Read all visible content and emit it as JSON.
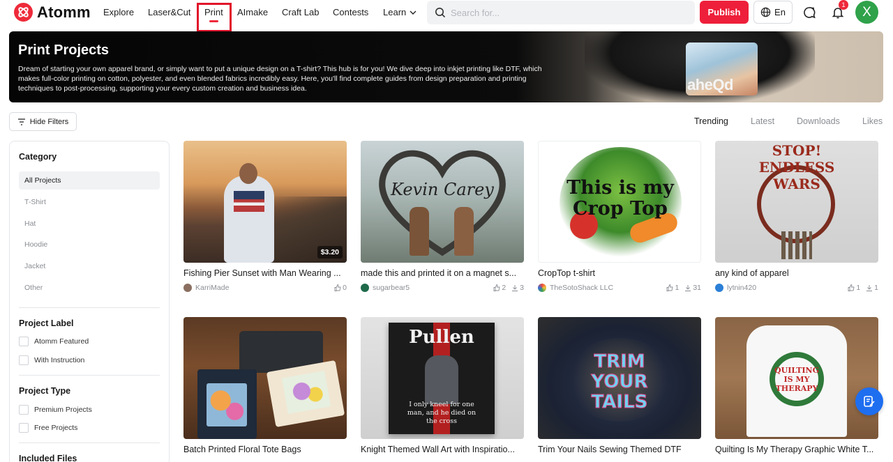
{
  "brand": {
    "name": "Atomm",
    "accent": "#ee2a3a"
  },
  "nav": {
    "items": [
      "Explore",
      "Laser&Cut",
      "Print",
      "AImake",
      "Craft Lab",
      "Contests",
      "Learn"
    ],
    "active": "Print"
  },
  "search": {
    "placeholder": "Search for..."
  },
  "header": {
    "publish_label": "Publish",
    "language": "En",
    "notification_count": "1",
    "user_initial": "X"
  },
  "hero": {
    "title": "Print Projects",
    "description": "Dream of starting your own apparel brand, or simply want to put a unique design on a T-shirt? This hub is for you! We dive deep into inkjet printing like DTF, which makes full-color printing on cotton, polyester, and even blended fabrics incredibly easy. Here, you'll find complete guides from design preparation and printing techniques to post-processing, supporting your every custom creation and business idea.",
    "image_text": "aheQd"
  },
  "filters": {
    "hide_label": "Hide Filters"
  },
  "sort": {
    "options": [
      "Trending",
      "Latest",
      "Downloads",
      "Likes"
    ],
    "active": "Trending"
  },
  "sidebar": {
    "category_title": "Category",
    "categories": [
      "All Projects",
      "T-Shirt",
      "Hat",
      "Hoodie",
      "Jacket",
      "Other"
    ],
    "active_category": "All Projects",
    "label_title": "Project Label",
    "labels": [
      "Atomm Featured",
      "With Instruction"
    ],
    "type_title": "Project Type",
    "types": [
      "Premium Projects",
      "Free Projects"
    ],
    "files_title": "Included Files"
  },
  "projects": [
    {
      "title": "Fishing Pier Sunset with Man Wearing ...",
      "author": "KarriMade",
      "likes": "0",
      "downloads": "",
      "price": "$3.20"
    },
    {
      "title": "made this and printed it on a magnet s...",
      "author": "sugarbear5",
      "likes": "2",
      "downloads": "3",
      "price": "",
      "image_text": "Kevin Carey"
    },
    {
      "title": "CropTop t-shirt",
      "author": "TheSotoShack LLC",
      "likes": "1",
      "downloads": "31",
      "price": "",
      "image_text": "This is my Crop Top"
    },
    {
      "title": "any kind of apparel",
      "author": "lytnin420",
      "likes": "1",
      "downloads": "1",
      "price": "",
      "image_text": "STOP! ENDLESS WARS"
    },
    {
      "title": "Batch Printed Floral Tote Bags",
      "author": "",
      "likes": "",
      "downloads": "",
      "price": ""
    },
    {
      "title": "Knight Themed Wall Art with Inspiratio...",
      "author": "",
      "likes": "",
      "downloads": "",
      "price": "",
      "image_text": "Pullen",
      "image_subtext": "I only kneel for one man, and he died on the cross"
    },
    {
      "title": "Trim Your Nails Sewing Themed DTF",
      "author": "",
      "likes": "",
      "downloads": "",
      "price": "",
      "image_text": "TRIM YOUR TAILS"
    },
    {
      "title": "Quilting Is My Therapy Graphic White T...",
      "author": "",
      "likes": "",
      "downloads": "",
      "price": "",
      "image_text": "QUILTING IS MY THERAPY"
    }
  ]
}
